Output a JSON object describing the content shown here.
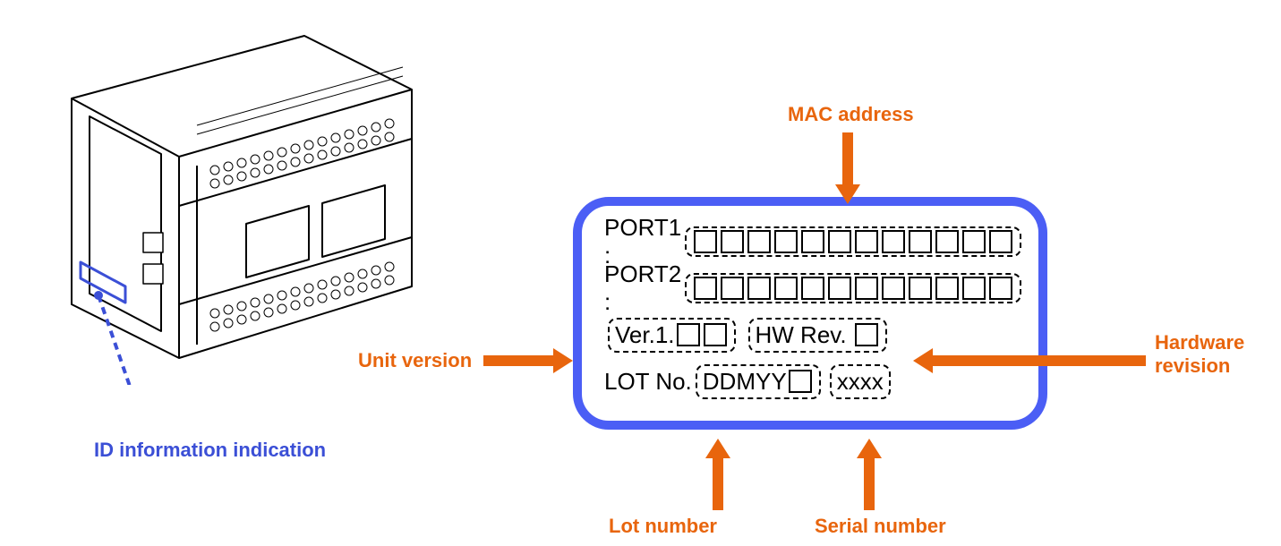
{
  "annotations": {
    "id_info": "ID information indication",
    "mac_address": "MAC address",
    "unit_version": "Unit version",
    "hardware_revision_l1": "Hardware",
    "hardware_revision_l2": "revision",
    "lot_number": "Lot number",
    "serial_number": "Serial number"
  },
  "label": {
    "port1": "PORT1 :",
    "port2": "PORT2 :",
    "ver_prefix": "Ver.1.",
    "hw_rev": "HW Rev.",
    "lot_no": "LOT No.",
    "lot_value": "DDMYY",
    "serial_value": "xxxx"
  }
}
